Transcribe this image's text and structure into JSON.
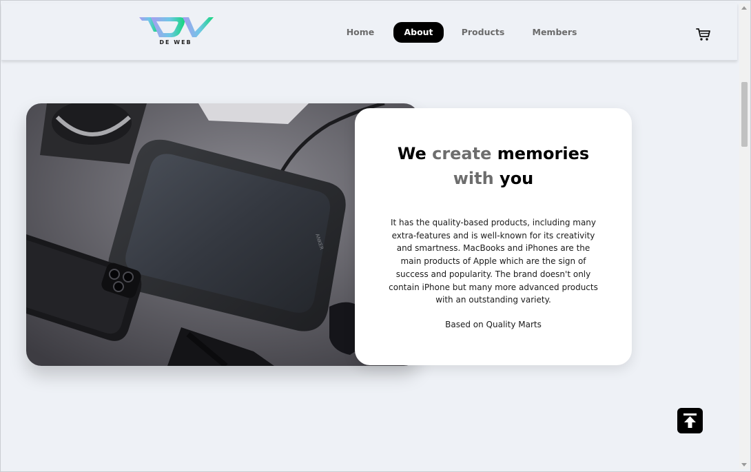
{
  "brand": {
    "logo_text": "DE WEB",
    "colors": {
      "gradient_start": "#a78bfa",
      "gradient_mid": "#6bc6e8",
      "gradient_end": "#10d87a"
    }
  },
  "nav": {
    "items": [
      {
        "label": "Home"
      },
      {
        "label": "About",
        "active": true
      },
      {
        "label": "Products"
      },
      {
        "label": "Members"
      }
    ],
    "cart_icon": "cart-icon"
  },
  "hero": {
    "image_alt": "tablet-and-phone-photo",
    "headline": {
      "w1": "We",
      "w2": "create",
      "w3": "memories",
      "w4": "with",
      "w5": "you"
    },
    "body": "It has the quality-based products, including many extra-features and is well-known for its creativity and smartness. MacBooks and iPhones are the main products of Apple which are the sign of success and popularity. The brand doesn't only contain iPhone but many more advanced products with an outstanding variety.",
    "source": "Based on Quality Marts"
  },
  "scroll_top_icon": "arrow-up-to-top-icon"
}
